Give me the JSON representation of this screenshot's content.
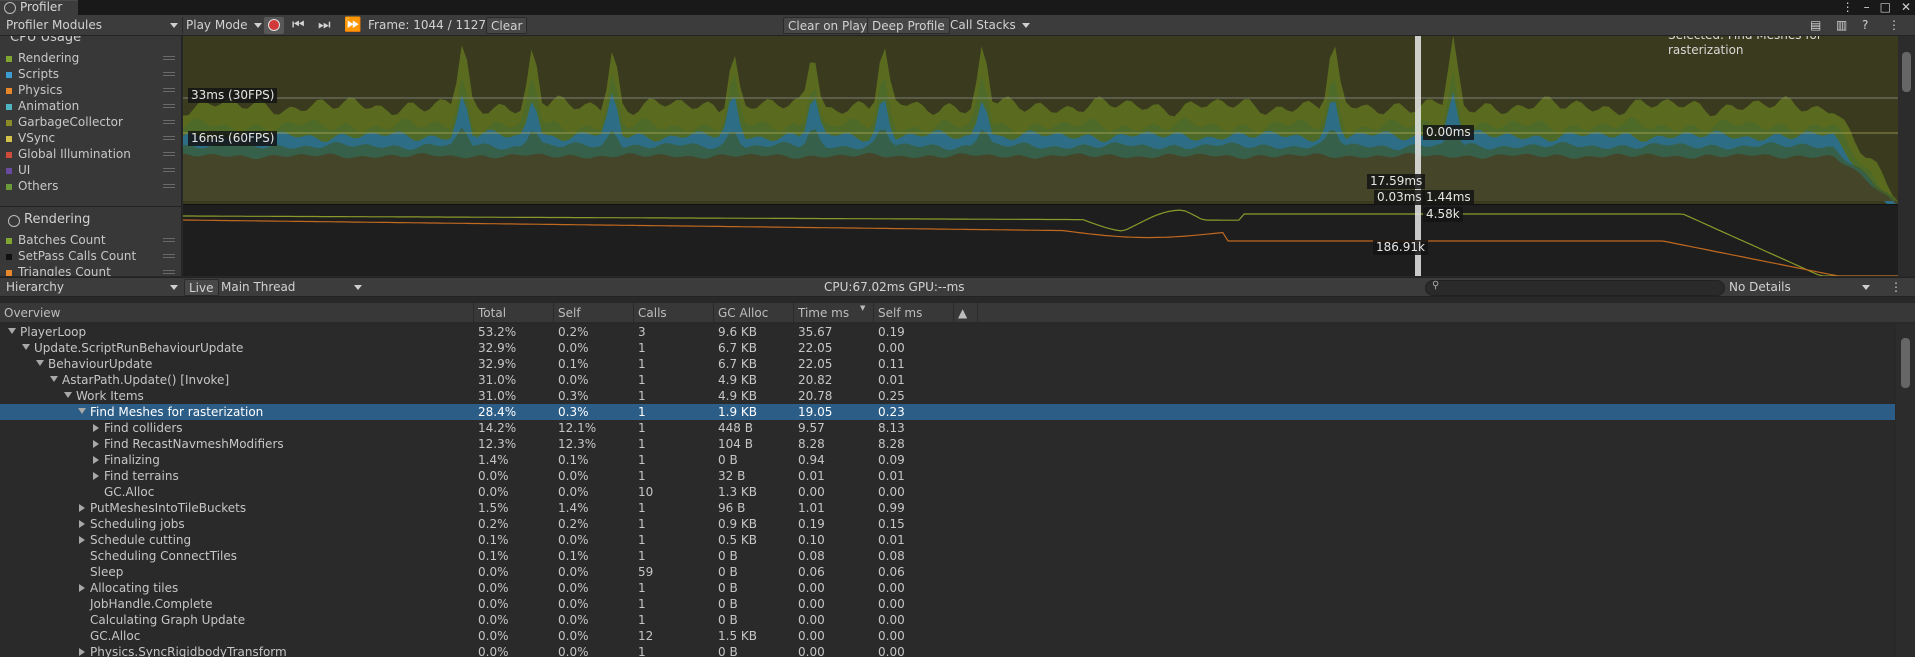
{
  "window": {
    "tab_title": "Profiler"
  },
  "toolbar": {
    "modules": "Profiler Modules",
    "play_mode": "Play Mode",
    "frame": "Frame: 1044 / 1127",
    "clear": "Clear",
    "clear_on_play": "Clear on Play",
    "deep_profile": "Deep Profile",
    "call_stacks": "Call Stacks"
  },
  "cpu_module": {
    "title": "CPU Usage",
    "legend": [
      {
        "label": "Rendering",
        "color": "#7ea630"
      },
      {
        "label": "Scripts",
        "color": "#3d9cd2"
      },
      {
        "label": "Physics",
        "color": "#e8862a"
      },
      {
        "label": "Animation",
        "color": "#4fb5c2"
      },
      {
        "label": "GarbageCollector",
        "color": "#8a8a28"
      },
      {
        "label": "VSync",
        "color": "#d2c24a"
      },
      {
        "label": "Global Illumination",
        "color": "#d04a3a"
      },
      {
        "label": "UI",
        "color": "#6a4aa0"
      },
      {
        "label": "Others",
        "color": "#6a9a3a"
      }
    ],
    "line_30fps": "33ms (30FPS)",
    "line_60fps": "16ms (60FPS)",
    "selected_text": "Selected: Find Meshes for rasterization",
    "readout_a": "0.00ms",
    "readout_b": "17.59ms",
    "readout_c": "0.03ms",
    "readout_d": "1.44ms"
  },
  "rendering_module": {
    "title": "Rendering",
    "legend": [
      {
        "label": "Batches Count",
        "color": "#7ea630"
      },
      {
        "label": "SetPass Calls Count",
        "color": "#111111"
      },
      {
        "label": "Triangles Count",
        "color": "#e8862a"
      }
    ],
    "readout_a": "4.58k",
    "readout_b": "186.91k"
  },
  "hierarchy_bar": {
    "view": "Hierarchy",
    "live": "Live",
    "thread": "Main Thread",
    "cpu_gpu": "CPU:67.02ms   GPU:--ms",
    "details": "No Details"
  },
  "columns": [
    "Overview",
    "Total",
    "Self",
    "Calls",
    "GC Alloc",
    "Time ms",
    "Self ms"
  ],
  "rows": [
    {
      "name": "PlayerLoop",
      "indent": 0,
      "fold": "open",
      "total": "53.2%",
      "self": "0.2%",
      "calls": "3",
      "gc": "9.6 KB",
      "time": "35.67",
      "selfms": "0.19"
    },
    {
      "name": "Update.ScriptRunBehaviourUpdate",
      "indent": 1,
      "fold": "open",
      "total": "32.9%",
      "self": "0.0%",
      "calls": "1",
      "gc": "6.7 KB",
      "time": "22.05",
      "selfms": "0.00"
    },
    {
      "name": "BehaviourUpdate",
      "indent": 2,
      "fold": "open",
      "total": "32.9%",
      "self": "0.1%",
      "calls": "1",
      "gc": "6.7 KB",
      "time": "22.05",
      "selfms": "0.11"
    },
    {
      "name": "AstarPath.Update() [Invoke]",
      "indent": 3,
      "fold": "open",
      "total": "31.0%",
      "self": "0.0%",
      "calls": "1",
      "gc": "4.9 KB",
      "time": "20.82",
      "selfms": "0.01"
    },
    {
      "name": "Work Items",
      "indent": 4,
      "fold": "open",
      "total": "31.0%",
      "self": "0.3%",
      "calls": "1",
      "gc": "4.9 KB",
      "time": "20.78",
      "selfms": "0.25"
    },
    {
      "name": "Find Meshes for rasterization",
      "indent": 5,
      "fold": "open",
      "selected": true,
      "total": "28.4%",
      "self": "0.3%",
      "calls": "1",
      "gc": "1.9 KB",
      "time": "19.05",
      "selfms": "0.23"
    },
    {
      "name": "Find colliders",
      "indent": 6,
      "fold": "closed",
      "total": "14.2%",
      "self": "12.1%",
      "calls": "1",
      "gc": "448 B",
      "time": "9.57",
      "selfms": "8.13"
    },
    {
      "name": "Find RecastNavmeshModifiers",
      "indent": 6,
      "fold": "closed",
      "total": "12.3%",
      "self": "12.3%",
      "calls": "1",
      "gc": "104 B",
      "time": "8.28",
      "selfms": "8.28"
    },
    {
      "name": "Finalizing",
      "indent": 6,
      "fold": "closed",
      "total": "1.4%",
      "self": "0.1%",
      "calls": "1",
      "gc": "0 B",
      "time": "0.94",
      "selfms": "0.09"
    },
    {
      "name": "Find terrains",
      "indent": 6,
      "fold": "closed",
      "total": "0.0%",
      "self": "0.0%",
      "calls": "1",
      "gc": "32 B",
      "time": "0.01",
      "selfms": "0.01"
    },
    {
      "name": "GC.Alloc",
      "indent": 6,
      "fold": "none",
      "total": "0.0%",
      "self": "0.0%",
      "calls": "10",
      "gc": "1.3 KB",
      "time": "0.00",
      "selfms": "0.00"
    },
    {
      "name": "PutMeshesIntoTileBuckets",
      "indent": 5,
      "fold": "closed",
      "total": "1.5%",
      "self": "1.4%",
      "calls": "1",
      "gc": "96 B",
      "time": "1.01",
      "selfms": "0.99"
    },
    {
      "name": "Scheduling jobs",
      "indent": 5,
      "fold": "closed",
      "total": "0.2%",
      "self": "0.2%",
      "calls": "1",
      "gc": "0.9 KB",
      "time": "0.19",
      "selfms": "0.15"
    },
    {
      "name": "Schedule cutting",
      "indent": 5,
      "fold": "closed",
      "total": "0.1%",
      "self": "0.0%",
      "calls": "1",
      "gc": "0.5 KB",
      "time": "0.10",
      "selfms": "0.01"
    },
    {
      "name": "Scheduling ConnectTiles",
      "indent": 5,
      "fold": "none",
      "total": "0.1%",
      "self": "0.1%",
      "calls": "1",
      "gc": "0 B",
      "time": "0.08",
      "selfms": "0.08"
    },
    {
      "name": "Sleep",
      "indent": 5,
      "fold": "none",
      "total": "0.0%",
      "self": "0.0%",
      "calls": "59",
      "gc": "0 B",
      "time": "0.06",
      "selfms": "0.06"
    },
    {
      "name": "Allocating tiles",
      "indent": 5,
      "fold": "closed",
      "total": "0.0%",
      "self": "0.0%",
      "calls": "1",
      "gc": "0 B",
      "time": "0.00",
      "selfms": "0.00"
    },
    {
      "name": "JobHandle.Complete",
      "indent": 5,
      "fold": "none",
      "total": "0.0%",
      "self": "0.0%",
      "calls": "1",
      "gc": "0 B",
      "time": "0.00",
      "selfms": "0.00"
    },
    {
      "name": "Calculating Graph Update",
      "indent": 5,
      "fold": "none",
      "total": "0.0%",
      "self": "0.0%",
      "calls": "1",
      "gc": "0 B",
      "time": "0.00",
      "selfms": "0.00"
    },
    {
      "name": "GC.Alloc",
      "indent": 5,
      "fold": "none",
      "total": "0.0%",
      "self": "0.0%",
      "calls": "12",
      "gc": "1.5 KB",
      "time": "0.00",
      "selfms": "0.00"
    },
    {
      "name": "Physics.SyncRigidbodyTransform",
      "indent": 5,
      "fold": "closed",
      "total": "0.0%",
      "self": "0.0%",
      "calls": "1",
      "gc": "0 B",
      "time": "0.00",
      "selfms": "0.00"
    }
  ]
}
